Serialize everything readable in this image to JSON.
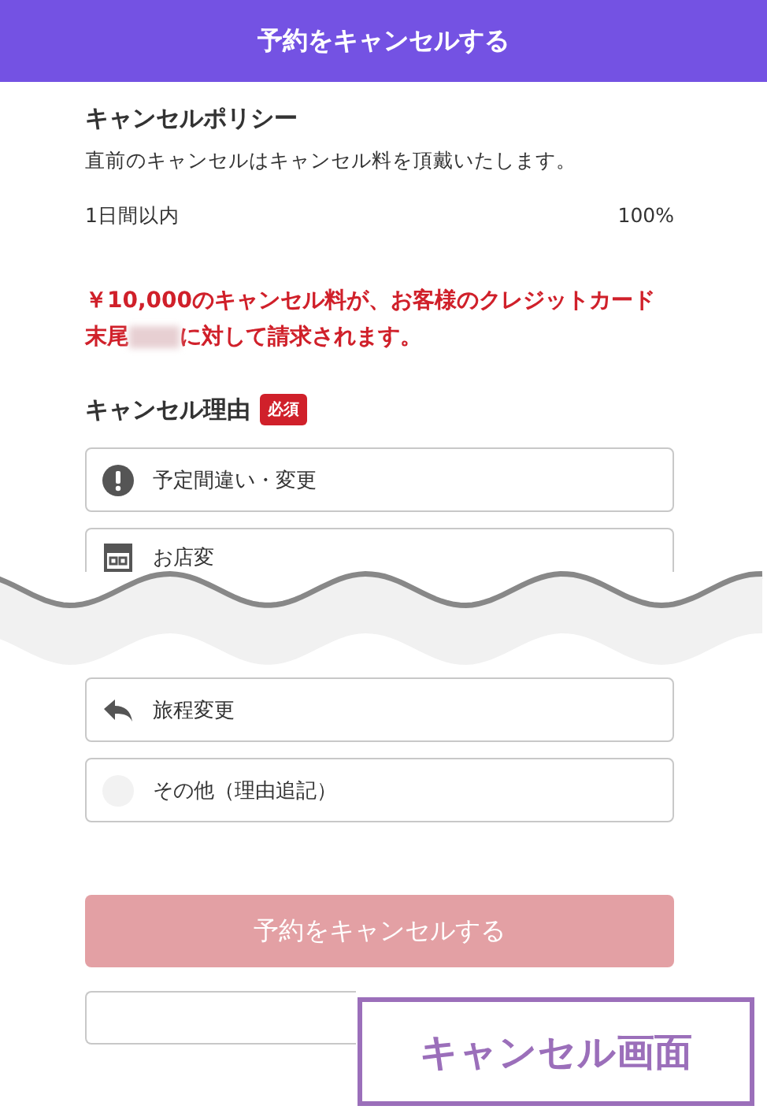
{
  "header": {
    "title": "予約をキャンセルする"
  },
  "policy": {
    "title": "キャンセルポリシー",
    "description": "直前のキャンセルはキャンセル料を頂戴いたします。",
    "rows": [
      {
        "period": "1日間以内",
        "rate": "100%"
      }
    ]
  },
  "notice": {
    "before": "￥10,000のキャンセル料が、お客様のクレジットカード末尾",
    "after": "に対して請求されます。"
  },
  "reasons": {
    "title": "キャンセル理由",
    "badge": "必須",
    "options": [
      {
        "label": "予定間違い・変更",
        "kind": "alert"
      },
      {
        "label": "お店変",
        "kind": "store"
      },
      {
        "kind": "hidden"
      },
      {
        "label": "旅程変更",
        "kind": "back"
      },
      {
        "label": "その他（理由追記）",
        "kind": "faint"
      }
    ]
  },
  "submit": {
    "label": "予約をキャンセルする",
    "disabled": true
  },
  "caption": "キャンセル画面"
}
